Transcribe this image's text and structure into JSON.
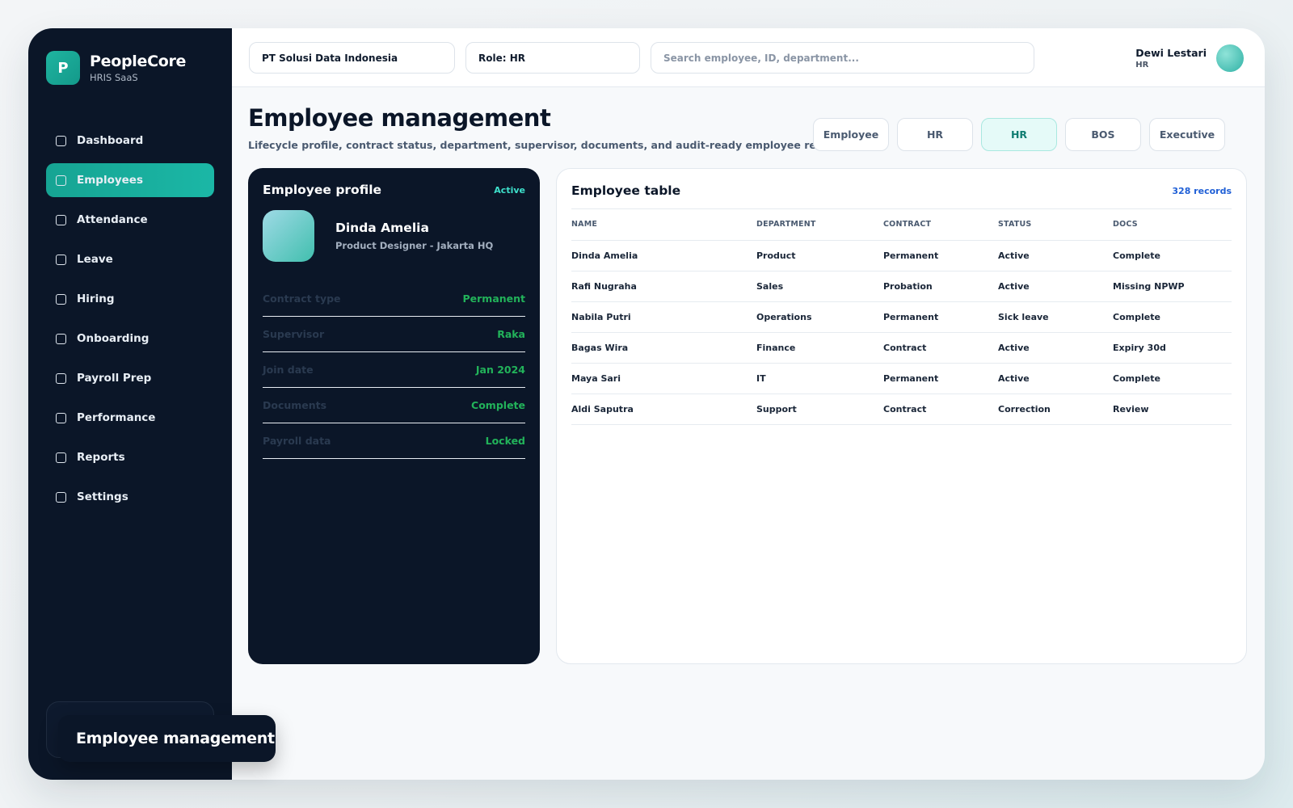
{
  "brand": {
    "logo_letter": "P",
    "name": "PeopleCore",
    "subtitle": "HRIS SaaS"
  },
  "sidebar": {
    "items": [
      {
        "label": "Dashboard",
        "active": false
      },
      {
        "label": "Employees",
        "active": true
      },
      {
        "label": "Attendance",
        "active": false
      },
      {
        "label": "Leave",
        "active": false
      },
      {
        "label": "Hiring",
        "active": false
      },
      {
        "label": "Onboarding",
        "active": false
      },
      {
        "label": "Payroll Prep",
        "active": false
      },
      {
        "label": "Performance",
        "active": false
      },
      {
        "label": "Reports",
        "active": false
      },
      {
        "label": "Settings",
        "active": false
      }
    ]
  },
  "toast": {
    "text": "Employee management"
  },
  "topbar": {
    "company": "PT Solusi Data Indonesia",
    "role": "Role: HR",
    "search_placeholder": "Search employee, ID, department...",
    "user_name": "Dewi Lestari",
    "user_role": "HR"
  },
  "header": {
    "title": "Employee management",
    "subtitle": "Lifecycle profile, contract status, department, supervisor, documents, and audit-ready employee records."
  },
  "role_tabs": [
    {
      "label": "Employee",
      "active": false
    },
    {
      "label": "HR",
      "active": false
    },
    {
      "label": "HR",
      "active": true
    },
    {
      "label": "BOS",
      "active": false
    },
    {
      "label": "Executive",
      "active": false
    }
  ],
  "profile": {
    "title": "Employee profile",
    "status": "Active",
    "name": "Dinda Amelia",
    "role": "Product Designer - Jakarta HQ",
    "facts": [
      {
        "label": "Contract type",
        "value": "Permanent"
      },
      {
        "label": "Supervisor",
        "value": "Raka"
      },
      {
        "label": "Join date",
        "value": "Jan 2024"
      },
      {
        "label": "Documents",
        "value": "Complete"
      },
      {
        "label": "Payroll data",
        "value": "Locked"
      }
    ]
  },
  "employee_table": {
    "title": "Employee table",
    "count": "328 records",
    "columns": [
      "NAME",
      "DEPARTMENT",
      "CONTRACT",
      "STATUS",
      "DOCS"
    ],
    "rows": [
      [
        "Dinda Amelia",
        "Product",
        "Permanent",
        "Active",
        "Complete"
      ],
      [
        "Rafi Nugraha",
        "Sales",
        "Probation",
        "Active",
        "Missing NPWP"
      ],
      [
        "Nabila Putri",
        "Operations",
        "Permanent",
        "Sick leave",
        "Complete"
      ],
      [
        "Bagas Wira",
        "Finance",
        "Contract",
        "Active",
        "Expiry 30d"
      ],
      [
        "Maya Sari",
        "IT",
        "Permanent",
        "Active",
        "Complete"
      ],
      [
        "Aldi Saputra",
        "Support",
        "Contract",
        "Correction",
        "Review"
      ]
    ]
  },
  "colors": {
    "accent": "#16a493",
    "sidebar_bg": "#0b1628",
    "positive": "#22b35a",
    "link": "#1f5fd6"
  }
}
